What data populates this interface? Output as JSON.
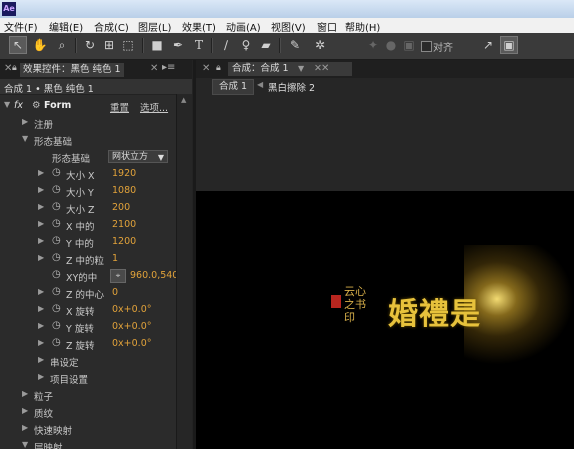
{
  "app": {
    "logo": "Ae"
  },
  "menu": [
    "文件(F)",
    "编辑(E)",
    "合成(C)",
    "图层(L)",
    "效果(T)",
    "动画(A)",
    "视图(V)",
    "窗口",
    "帮助(H)"
  ],
  "toolbar": {
    "icons": [
      "select-arrow",
      "hand",
      "zoom",
      "rotate",
      "camera-orbit",
      "pan-behind",
      "rectangle-mask",
      "pen",
      "type",
      "brush",
      "clone-stamp",
      "eraser",
      "roto-brush",
      "puppet-pin"
    ],
    "snap_label": "对齐"
  },
  "effect_controls": {
    "tab_label": "效果控件：黑色 纯色 1",
    "breadcrumb": "合成 1 • 黑色 纯色 1",
    "effect": {
      "name": "Form",
      "reset": "重置",
      "options": "选项..."
    },
    "rows": {
      "register": "注册",
      "base_form": "形态基础",
      "base_form_label": "形态基础",
      "base_form_value": "网状立方",
      "size_x": "大小 X",
      "size_x_val": "1920",
      "size_y": "大小 Y",
      "size_y_val": "1080",
      "size_z": "大小 Z",
      "size_z_val": "200",
      "center_x": "X 中的",
      "center_x_val": "2100",
      "center_y": "Y 中的",
      "center_y_val": "1200",
      "center_z": "Z 中的粒",
      "center_z_val": "1",
      "xy_center": "XY的中",
      "xy_center_val": "960.0,540",
      "z_center": "Z 的中心",
      "z_center_val": "0",
      "x_rot": "X 旋转",
      "x_rot_val": "0x+0.0°",
      "y_rot": "Y 旋转",
      "y_rot_val": "0x+0.0°",
      "z_rot": "Z 旋转",
      "z_rot_val": "0x+0.0°",
      "string_settings": "串设定",
      "project_settings": "项目设置",
      "particles": "粒子",
      "shading": "质纹",
      "quick_map": "快速映射",
      "layer_map": "层映射"
    }
  },
  "composition": {
    "tab_label": "合成：合成 1",
    "sub_tab": "合成 1",
    "layer_crumb": "黑白擦除 2"
  },
  "viewer": {
    "calligraphy_small": "云心之书印",
    "title": "婚禮是"
  },
  "colors": {
    "accent": "#e1a23a",
    "panel": "#2b2b2b",
    "viewer_bg": "#000000"
  }
}
